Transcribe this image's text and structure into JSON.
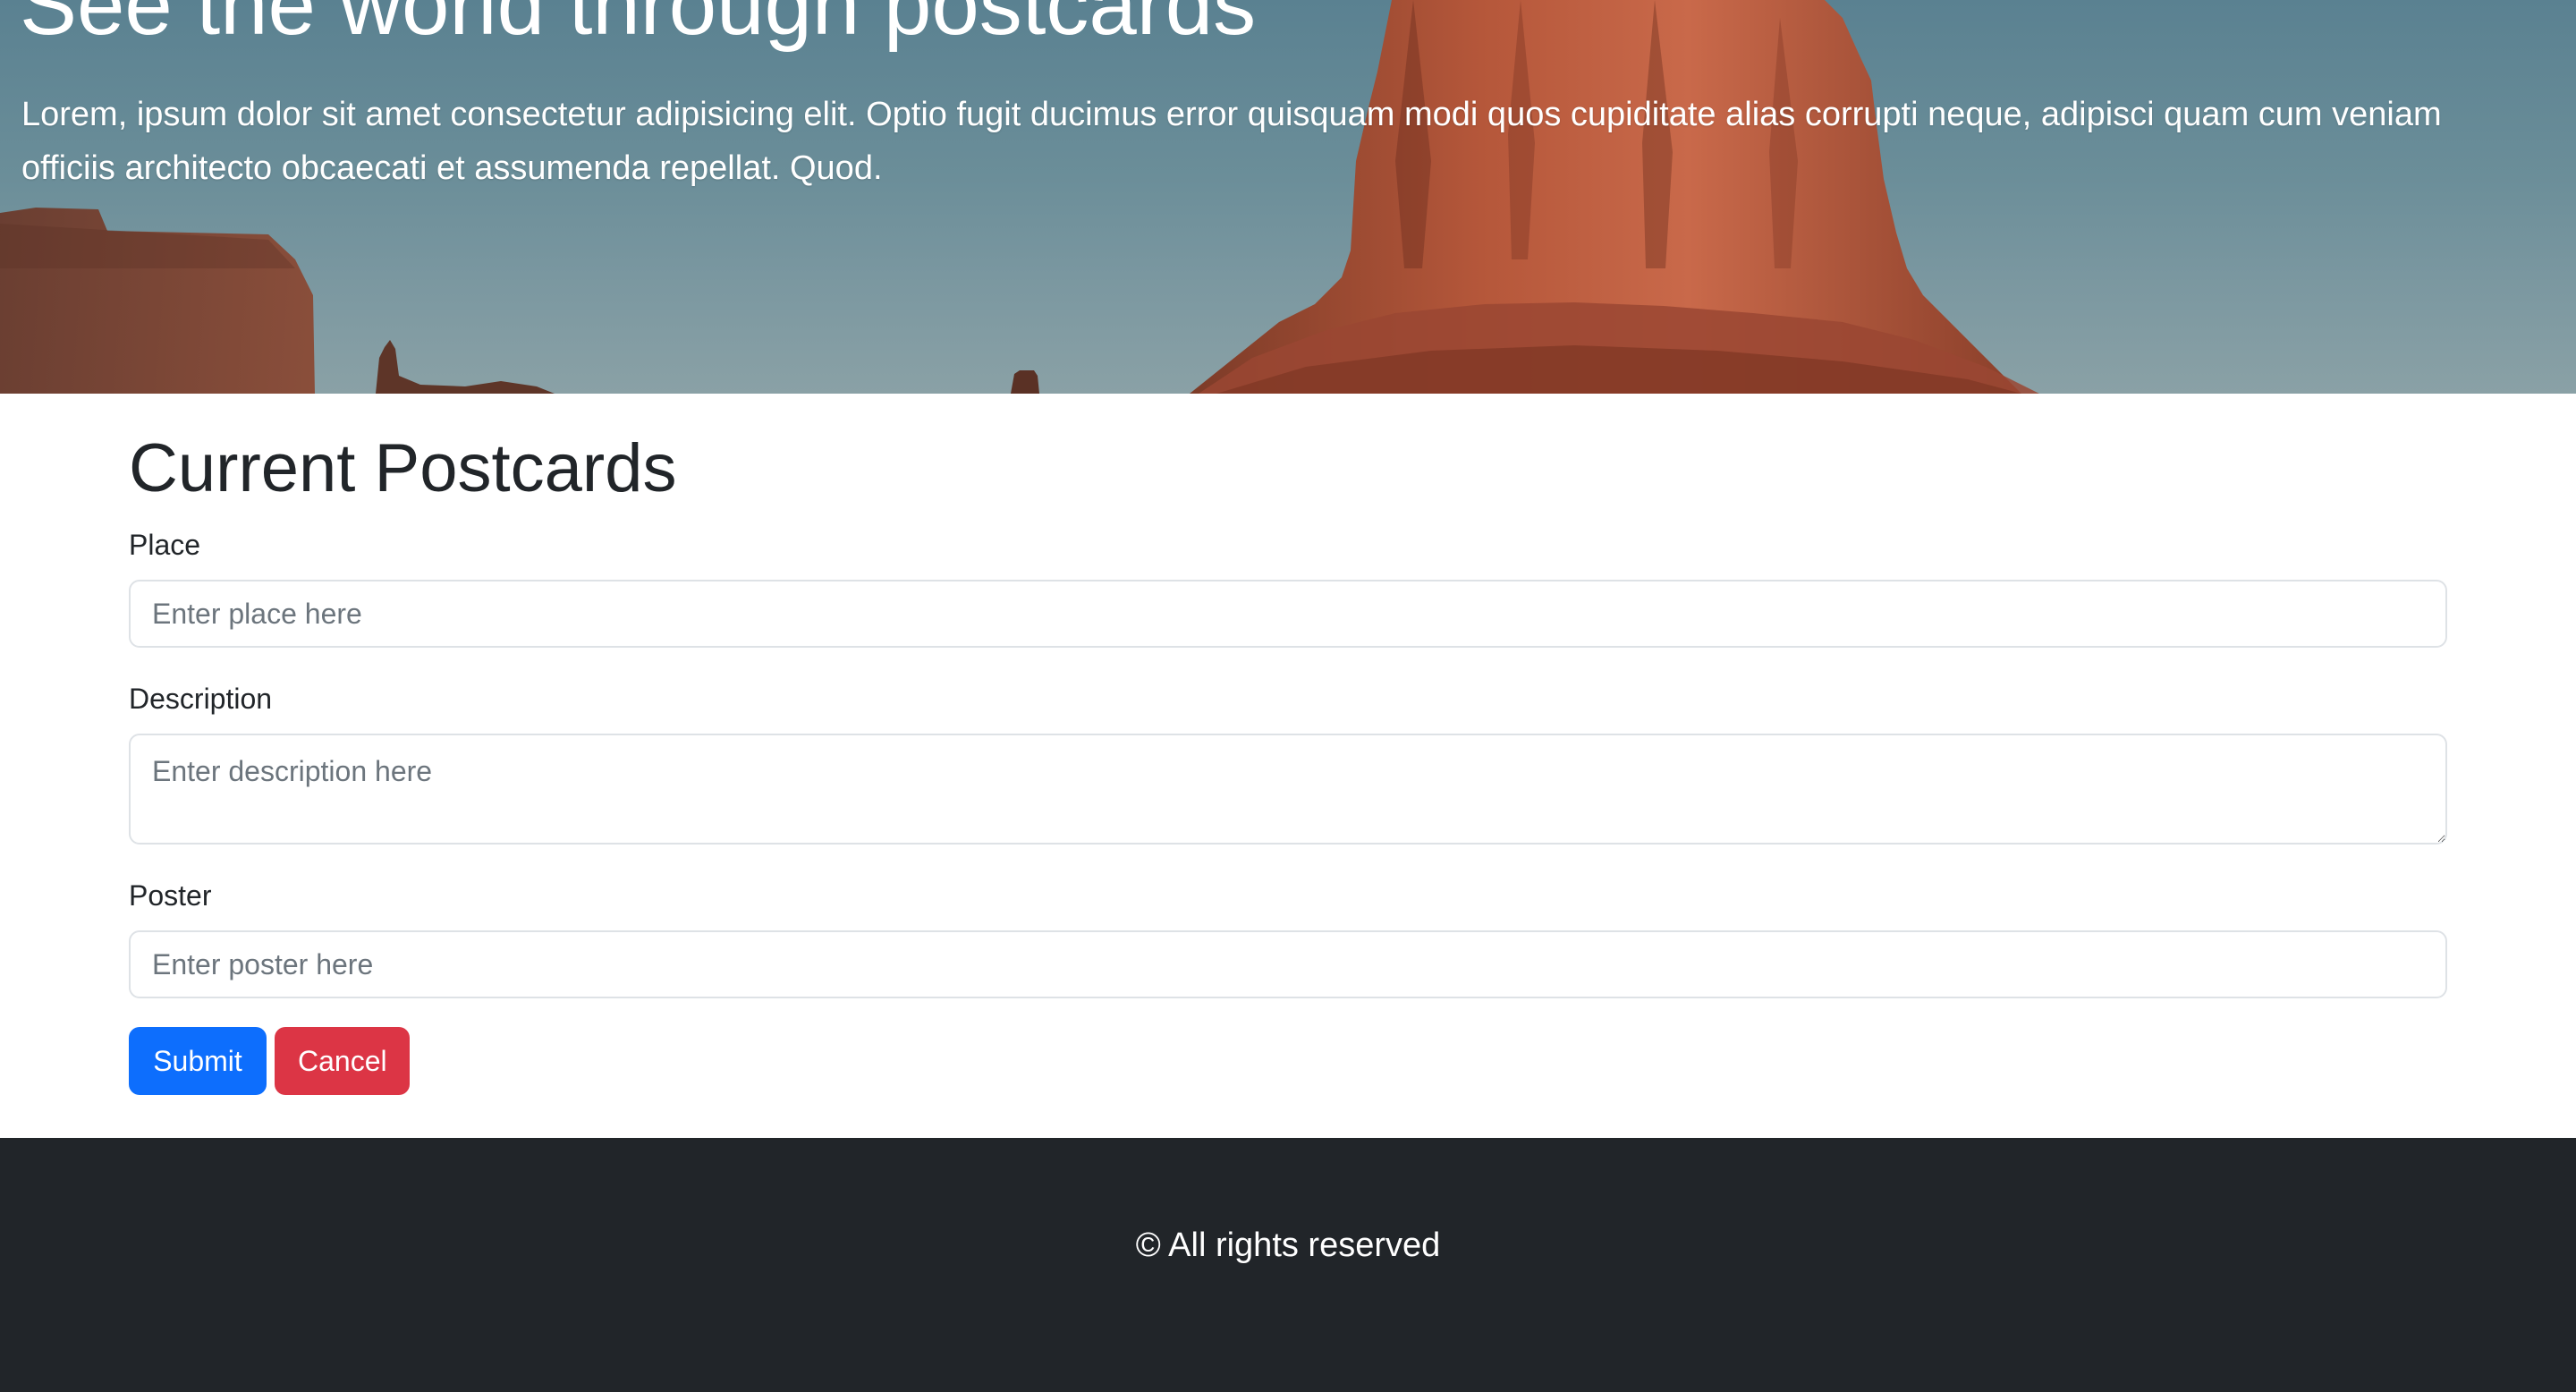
{
  "hero": {
    "title": "See the world through postcards",
    "lead": "Lorem, ipsum dolor sit amet consectetur adipisicing elit. Optio fugit ducimus error quisquam modi quos cupiditate alias corrupti neque, adipisci quam cum veniam officiis architecto obcaecati et assumenda repellat. Quod.",
    "background_image": "desert-butte-photo"
  },
  "form": {
    "title": "Current Postcards",
    "place": {
      "label": "Place",
      "placeholder": "Enter place here",
      "value": ""
    },
    "description": {
      "label": "Description",
      "placeholder": "Enter description here",
      "value": ""
    },
    "poster": {
      "label": "Poster",
      "placeholder": "Enter poster here",
      "value": ""
    },
    "submit_label": "Submit",
    "cancel_label": "Cancel"
  },
  "footer": {
    "text": "© All rights reserved"
  },
  "colors": {
    "primary": "#0d6efd",
    "danger": "#dc3545",
    "footer_bg": "#212529",
    "text": "#212529",
    "border": "#dee2e6"
  }
}
